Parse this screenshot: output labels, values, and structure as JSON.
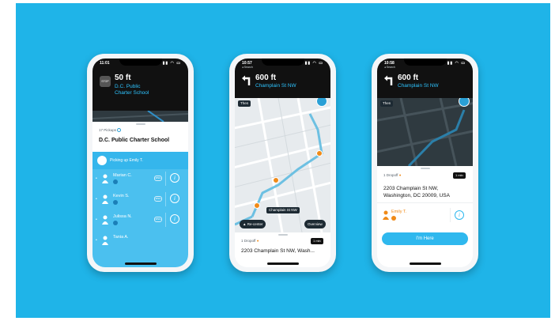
{
  "colors": {
    "background_panel": "#1fb4e8",
    "accent_blue": "#2ec4ff",
    "orange": "#f08a18",
    "dark": "#111111"
  },
  "phone1": {
    "time": "11:01",
    "stop_badge": "STOP",
    "distance": "50 ft",
    "street_line1": "D.C. Public",
    "street_line2": "Charter School",
    "pickups_label": "17 Pickups",
    "stop_name": "D.C. Public Charter School",
    "status_text": "Picking up Emily T.",
    "passengers": [
      {
        "name": "Marian C.",
        "msg": "MSG"
      },
      {
        "name": "Kevin S.",
        "msg": "MSG"
      },
      {
        "name": "Julissa N.",
        "msg": "MSG"
      },
      {
        "name": "Tania A.",
        "msg": ""
      }
    ],
    "icons": {
      "person": "person-icon",
      "info": "info-icon",
      "message": "message-icon"
    }
  },
  "phone2": {
    "time": "10:57",
    "back_label": "◂ Search",
    "distance": "600 ft",
    "street": "Champlain St NW",
    "then_label": "Then",
    "street_tag": "Champlain St NW",
    "recenter": "Re-center",
    "overview": "Overview",
    "dropoff_label": "1 Dropoff",
    "eta": "1 min",
    "address_line": "2203 Champlain St NW, Wash..."
  },
  "phone3": {
    "time": "10:58",
    "back_label": "◂ Search",
    "distance": "600 ft",
    "street": "Champlain St NW",
    "then_label": "Then",
    "dropoff_label": "1 Dropoff",
    "eta": "1 min",
    "address_line1": "2203 Champlain St NW,",
    "address_line2": "Washington, DC 20009, USA",
    "rider": "Emily T.",
    "cta": "I'm Here"
  }
}
